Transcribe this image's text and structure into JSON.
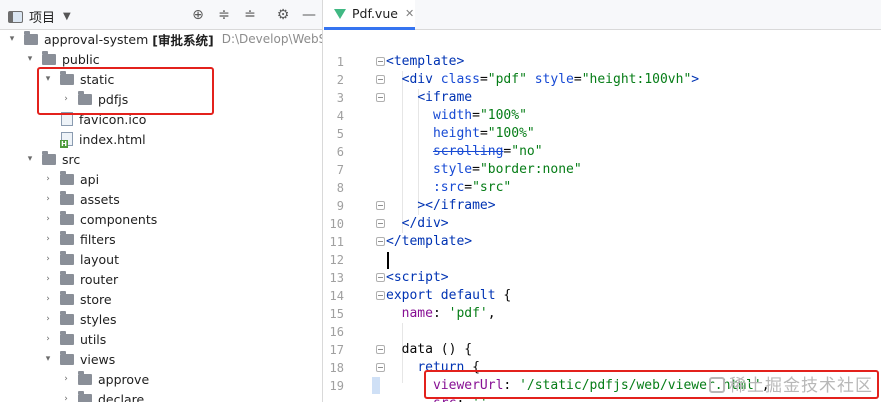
{
  "project_pane": {
    "title": "项目",
    "toolbar_icons": [
      "target-icon",
      "expand-all-icon",
      "collapse-all-icon",
      "gear-icon",
      "minimize-icon"
    ]
  },
  "tree": {
    "root": {
      "name": "approval-system",
      "bold_label": "[审批系统]",
      "path": "D:\\Develop\\WebSto"
    },
    "public": "public",
    "static": "static",
    "pdfjs": "pdfjs",
    "favicon": "favicon.ico",
    "index_html": "index.html",
    "src": "src",
    "src_children": [
      "api",
      "assets",
      "components",
      "filters",
      "layout",
      "router",
      "store",
      "styles",
      "utils",
      "views"
    ],
    "views_children": [
      "approve",
      "declare"
    ]
  },
  "editor": {
    "tab_label": "Pdf.vue",
    "line_numbers": [
      "1",
      "2",
      "3",
      "4",
      "5",
      "6",
      "7",
      "8",
      "9",
      "10",
      "11",
      "12",
      "13",
      "14",
      "15",
      "16",
      "17",
      "18",
      "19"
    ]
  },
  "colors": {
    "highlight_box": "#e3211c",
    "tab_accent": "#3574f0",
    "vue_green": "#41b883"
  },
  "watermark": "稀土掘金技术社区"
}
